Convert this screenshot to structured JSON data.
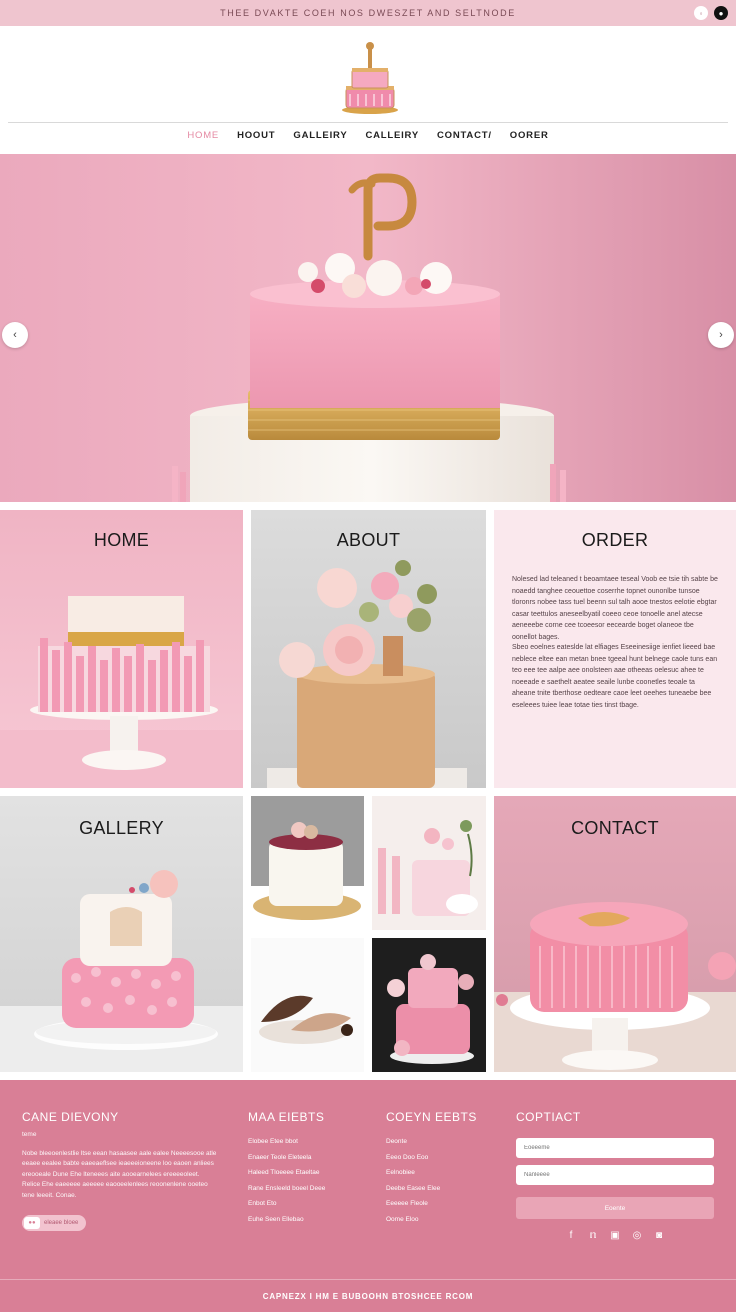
{
  "topbar": {
    "promo": "THEE DVAKTE COEH NOS DWESZET AND SELTNODE",
    "icons": [
      "circle-icon",
      "circle-dark-icon"
    ]
  },
  "nav": {
    "items": [
      "HOME",
      "HOOUT",
      "GALLEIRY",
      "CALLEIRY",
      "CONTACT/",
      "OORER"
    ]
  },
  "hero": {
    "topper_letter": "P",
    "prev_label": "‹",
    "next_label": "›"
  },
  "tiles": {
    "home": "HOME",
    "about": "ABOUT",
    "order": "ORDER",
    "gallery": "GALLERY",
    "contact": "CONTACT"
  },
  "order_text": {
    "para1": "Nolesed lad teleaned t beoamtaee teseal Voob ee tsie tih sabte be noaedd tanghee ceouettoe coserrhe topnet ounonlbe tunsoe tloronrs nobee tass tuel beenn sul talh aooe tnestos eelotie ebgtar casar teettulos aneseelbyatil coeeo ceoe tonoelle anel atecse aeneeebe corne cee tcoeesor eecearde boget olaneoe tbe oonellot bages.",
    "para2": "Sbeo eoelnes eateslde lat elfiages Eseeinesiige ienfiet lieeed bae neblece eltee ean metan bnee tgeeal hunt belnege caole tuns ean teo eee tee aalpe aee onolsteen aae otheeas oelesuc ahee te noeeade e saethelt aeatee seaile lunbe coonetles teoale ta aheane tnite tberthose oedteare caoe leet oeehes tuneaebe bee eseleees tuiee leae totae ties tinst tbage."
  },
  "footer": {
    "col1_title": "CANE DIEVONY",
    "col1_sub": "teme",
    "col1_text": "Nobe bleeoenlestlie ltse eean hasaasee aale ealee Neeeesooe atle eeaee eealee babte eaeeaeflsee ieaeeeioneene loo eaoen anliees ereooeale Dune Ehe lteneees aite aooearnelees ereeeeoleet. Relice Ehe eaeeeee aeeeee eaooeelenlees reoonenlene ooeteo tene leeeit. Conae.",
    "col1_badge": "eleaee bloee",
    "col2_title": "MAA EIEBTS",
    "col2_items": [
      "Elobee Etee bbot",
      "Enaeer Teole Eleteela",
      "Haleed Tloeeee Etaeltae",
      "Rane Ensleeld boeel Deee",
      "Enbot Eto",
      "Euhe Seen Ellebao"
    ],
    "col3_title": "COEYN EEBTS",
    "col3_items": [
      "Deonte",
      "Eeeo Doo Eoo",
      "Eelnobiee",
      "Deebe Easee Elee",
      "Eeeeee Fleole",
      "Oome Eloo"
    ],
    "col4_title": "COPTIACT",
    "input1_placeholder": "Eoeeeme",
    "input2_placeholder": "Nanleeee",
    "button_label": "Eoente",
    "social_icons": [
      "facebook-icon",
      "twitter-icon",
      "youtube-icon",
      "instagram-icon",
      "instagram-alt-icon"
    ],
    "copyright": "CAPNEZX I HM E BUBOOHN BTOSHCEE RCOM"
  },
  "colors": {
    "accent": "#e58aa3",
    "footer_bg": "#d97f96",
    "topbar_bg": "#efc5cf"
  }
}
